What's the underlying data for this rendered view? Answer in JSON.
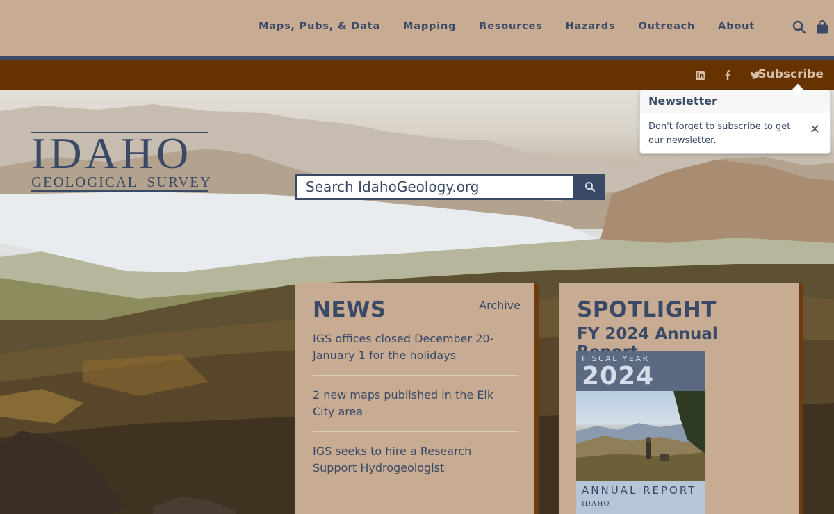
{
  "nav": {
    "items": [
      {
        "label": "Maps, Pubs, & Data"
      },
      {
        "label": "Mapping"
      },
      {
        "label": "Resources"
      },
      {
        "label": "Hazards"
      },
      {
        "label": "Outreach"
      },
      {
        "label": "About"
      }
    ],
    "icons": [
      "search-icon",
      "shopping-bag-icon"
    ]
  },
  "social": {
    "icons": [
      "linkedin-icon",
      "facebook-icon",
      "twitter-icon"
    ],
    "subscribe_label": "Subscribe"
  },
  "logo": {
    "main": "IDAHO",
    "sub": "GEOLOGICAL  SURVEY"
  },
  "search": {
    "placeholder": "Search IdahoGeology.org"
  },
  "popover": {
    "title": "Newsletter",
    "body": "Don't forget to subscribe to get our newsletter."
  },
  "news": {
    "title": "NEWS",
    "archive_label": "Archive",
    "items": [
      {
        "text": "IGS offices closed December 20-January 1 for the holidays"
      },
      {
        "text": "2 new maps published in the Elk City area"
      },
      {
        "text": "IGS seeks to hire a Research Support Hydrogeologist"
      }
    ]
  },
  "spotlight": {
    "title": "SPOTLIGHT",
    "subtitle": "FY 2024 Annual Report",
    "report": {
      "fiscal_year_label": "FISCAL YEAR",
      "year": "2024",
      "label": "ANNUAL REPORT",
      "publisher": "IDAHO"
    }
  },
  "colors": {
    "tan": "#c8ab93",
    "navy": "#3a4a66",
    "brown": "#663300"
  }
}
